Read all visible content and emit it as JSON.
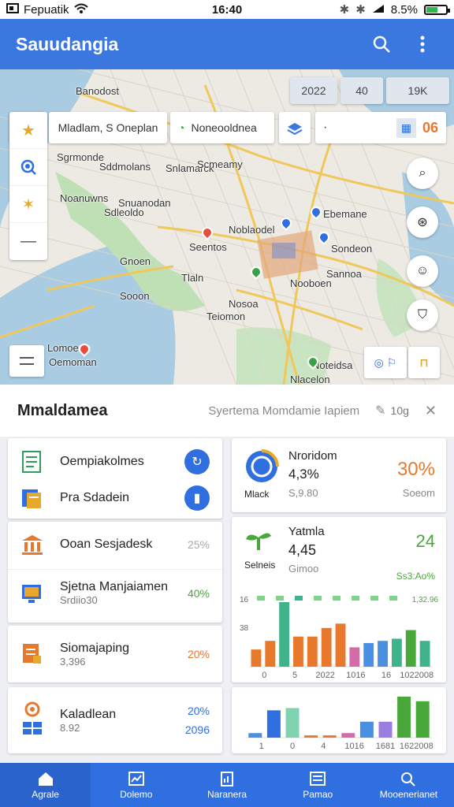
{
  "status": {
    "carrier": "Fepuatik",
    "time": "16:40",
    "battery": "8.5%"
  },
  "app": {
    "title": "Sauudangia"
  },
  "map": {
    "top_chips": [
      "2022",
      "40",
      "19K"
    ],
    "search_from": "Mladlam, S Oneplan",
    "search_to": "Noneooldnea",
    "stat_value": "06",
    "labels": [
      "Banodost",
      "Sgrmonde",
      "Sddmolans",
      "Noanuwns",
      "Sdleoldo",
      "Seentos",
      "Teiomon",
      "Lomoean",
      "Oemoman",
      "Sooon",
      "Snlamarck",
      "Nosoa",
      "Noblaodel",
      "Sannoa",
      "Tlaln",
      "Gnoen",
      "Ebemane",
      "Nlacelon",
      "Sondeon",
      "Snuanodan",
      "Nooboen",
      "Scmeamy",
      "Noteidsa"
    ]
  },
  "panel": {
    "title": "Mmaldamea",
    "subtitle": "Syertema Momdamie Iapiem",
    "trailing": "10g"
  },
  "list_left": [
    {
      "label": "Oempiakolmes"
    },
    {
      "label": "Pra Sdadein"
    },
    {
      "label": "Ooan Sesjadesk",
      "pct": "25%"
    },
    {
      "label": "Sjetna Manjaiamen",
      "sub": "Srdiio30",
      "pct": "40%"
    },
    {
      "label": "Siomajaping",
      "sub": "3,396",
      "pct": "20%"
    },
    {
      "label": "Kaladlean",
      "sub": "8.92",
      "pct": "20%",
      "pct2": "2096"
    }
  ],
  "stat_cards": [
    {
      "title": "Nroridom",
      "value": "4,3%",
      "sub": "S,9.80",
      "caption": "Mlack",
      "big": "30%",
      "big_sub": "Soeom"
    },
    {
      "title": "Yatmla",
      "value": "4,45",
      "sub": "Gimoo",
      "caption": "Selneis",
      "big": "24",
      "big_sub": "Ss3:Ao%"
    }
  ],
  "chart_data": [
    {
      "type": "bar",
      "categories": [
        "0",
        "5",
        "2022",
        "1016",
        "16",
        "1022008"
      ],
      "series": [
        {
          "values": [
            8,
            12,
            30,
            14,
            14,
            18,
            20,
            9,
            11,
            12,
            13,
            17,
            12
          ]
        }
      ],
      "top_labels": [
        "16",
        "1,32.96"
      ],
      "side_label": "38",
      "tick_labels": [
        "0",
        "5",
        "2022",
        "1016",
        "16",
        "1022008"
      ]
    },
    {
      "type": "bar",
      "series": [
        {
          "values": [
            2,
            12,
            13,
            1,
            1,
            2,
            7,
            7,
            18,
            16
          ]
        }
      ],
      "tick_labels": [
        "1",
        "0",
        "4",
        "1016",
        "1681",
        "1622008"
      ]
    }
  ],
  "bottom_nav": [
    {
      "label": "Agrale",
      "active": true
    },
    {
      "label": "Dolemo"
    },
    {
      "label": "Naranera"
    },
    {
      "label": "Pamao"
    },
    {
      "label": "Mooenerianet"
    }
  ],
  "colors": {
    "primary": "#3a78e0",
    "nav": "#2f6fe0",
    "green": "#49a83a",
    "orange": "#e8782c",
    "teal": "#3fb38a"
  }
}
